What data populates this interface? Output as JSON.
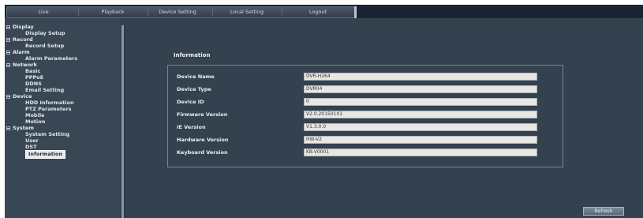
{
  "tabs": [
    "Live",
    "Playback",
    "Device Setting",
    "Local Setting",
    "Logout"
  ],
  "menu": [
    {
      "label": "Display",
      "items": [
        "Display Setup"
      ]
    },
    {
      "label": "Record",
      "items": [
        "Record Setup"
      ]
    },
    {
      "label": "Alarm",
      "items": [
        "Alarm Parameters"
      ]
    },
    {
      "label": "Network",
      "items": [
        "Basic",
        "PPPoE",
        "DDNS",
        "Email Setting"
      ]
    },
    {
      "label": "Device",
      "items": [
        "HDD Information",
        "PTZ Parameters",
        "Mobile",
        "Motion"
      ]
    },
    {
      "label": "System",
      "items": [
        "System Setting",
        "User",
        "DST",
        "Information"
      ]
    }
  ],
  "selected_item": "Information",
  "panel": {
    "title": "Information",
    "rows": [
      {
        "label": "Device Name",
        "value": "DVR-H264"
      },
      {
        "label": "Device Type",
        "value": "DVR04"
      },
      {
        "label": "Device ID",
        "value": "0"
      },
      {
        "label": "Firmware Version",
        "value": "V2.0.20150101"
      },
      {
        "label": "IE Version",
        "value": "V1.3.0.0"
      },
      {
        "label": "Hardware Version",
        "value": "HW-V2"
      },
      {
        "label": "Keyboard Version",
        "value": "KB-V0001"
      }
    ]
  },
  "refresh_label": "Refresh",
  "colors": {
    "background": "#34414f",
    "topbar": "#1b2532",
    "field": "#e8e7e3"
  }
}
